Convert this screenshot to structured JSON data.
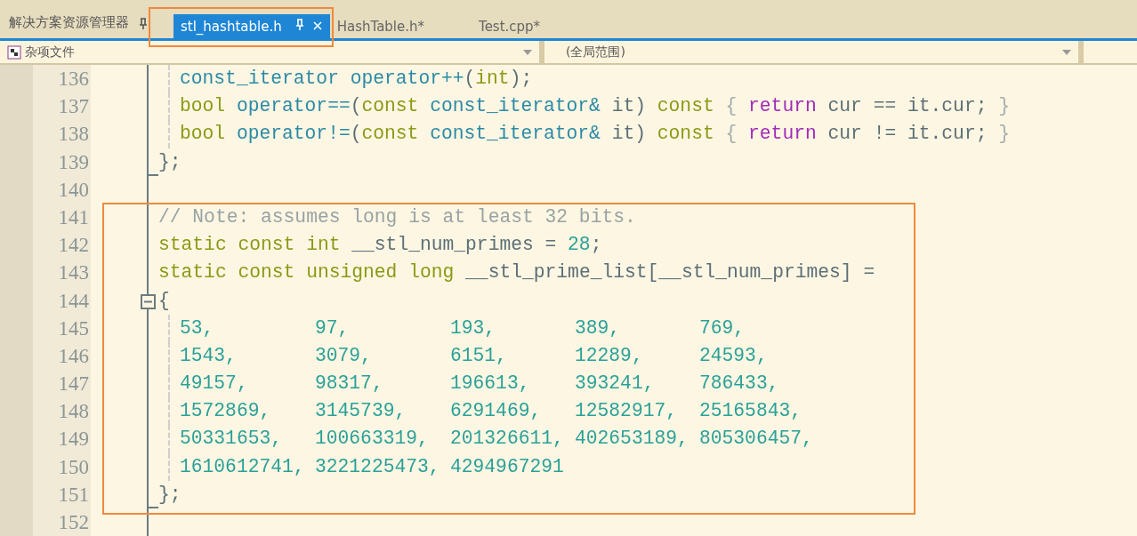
{
  "panel_title": "解决方案资源管理器",
  "tabs": [
    {
      "label": "stl_hashtable.h",
      "selected": true,
      "highlighted": true
    },
    {
      "label": "HashTable.h*",
      "selected": false,
      "highlighted": false
    },
    {
      "label": "Test.cpp*",
      "selected": false,
      "highlighted": false
    }
  ],
  "nav": {
    "project": "杂项文件",
    "scope": "(全局范围)"
  },
  "code_blocks": [
    {
      "framed": false,
      "lines": [
        {
          "number": "136",
          "kind": "body",
          "tokens": [
            {
              "t": "const_iterator operator++",
              "kind": "type"
            },
            {
              "t": "(",
              "kind": "plain"
            },
            {
              "t": "int",
              "kind": "keyword"
            },
            {
              "t": ");",
              "kind": "plain"
            }
          ]
        },
        {
          "number": "137",
          "kind": "body",
          "tokens": [
            {
              "t": "bool",
              "kind": "keyword"
            },
            {
              "t": " operator==",
              "kind": "type"
            },
            {
              "t": "(",
              "kind": "plain"
            },
            {
              "t": "const",
              "kind": "keyword"
            },
            {
              "t": " const_iterator&",
              "kind": "type"
            },
            {
              "t": " it)",
              "kind": "plain"
            },
            {
              "t": " const",
              "kind": "keyword"
            },
            {
              "t": " {",
              "kind": "brace"
            },
            {
              "t": " return",
              "kind": "control"
            },
            {
              "t": " cur == it.cur;",
              "kind": "plain"
            },
            {
              "t": " }",
              "kind": "brace"
            }
          ]
        },
        {
          "number": "138",
          "kind": "body",
          "tokens": [
            {
              "t": "bool",
              "kind": "keyword"
            },
            {
              "t": " operator!=",
              "kind": "type"
            },
            {
              "t": "(",
              "kind": "plain"
            },
            {
              "t": "const",
              "kind": "keyword"
            },
            {
              "t": " const_iterator&",
              "kind": "type"
            },
            {
              "t": " it)",
              "kind": "plain"
            },
            {
              "t": " const",
              "kind": "keyword"
            },
            {
              "t": " {",
              "kind": "brace"
            },
            {
              "t": " return",
              "kind": "control"
            },
            {
              "t": " cur != it.cur;",
              "kind": "plain"
            },
            {
              "t": " }",
              "kind": "brace"
            }
          ]
        },
        {
          "number": "139",
          "kind": "top",
          "block_end": true,
          "tokens": [
            {
              "t": "};",
              "kind": "plain"
            }
          ]
        },
        {
          "number": "140",
          "kind": "top"
        }
      ]
    },
    {
      "framed": true,
      "lines": [
        {
          "number": "141",
          "kind": "top",
          "tokens": [
            {
              "t": "// Note: assumes long is at least 32 bits.",
              "kind": "comment"
            }
          ]
        },
        {
          "number": "142",
          "kind": "top",
          "tokens": [
            {
              "t": "static const int",
              "kind": "keyword"
            },
            {
              "t": " __stl_num_primes = ",
              "kind": "plain"
            },
            {
              "t": "28",
              "kind": "number"
            },
            {
              "t": ";",
              "kind": "plain"
            }
          ]
        },
        {
          "number": "143",
          "kind": "top",
          "tokens": [
            {
              "t": "static const unsigned long",
              "kind": "keyword"
            },
            {
              "t": " __stl_prime_list[__stl_num_primes] =",
              "kind": "plain"
            }
          ]
        },
        {
          "number": "144",
          "kind": "top",
          "expanded": true,
          "tokens": [
            {
              "t": "{",
              "kind": "plain"
            }
          ]
        },
        {
          "number": "145",
          "kind": "cells",
          "cells": [
            "53,",
            "97,",
            "193,",
            "389,",
            "769,"
          ]
        },
        {
          "number": "146",
          "kind": "cells",
          "cells": [
            "1543,",
            "3079,",
            "6151,",
            "12289,",
            "24593,"
          ]
        },
        {
          "number": "147",
          "kind": "cells",
          "cells": [
            "49157,",
            "98317,",
            "196613,",
            "393241,",
            "786433,"
          ]
        },
        {
          "number": "148",
          "kind": "cells",
          "cells": [
            "1572869,",
            "3145739,",
            "6291469,",
            "12582917,",
            "25165843,"
          ]
        },
        {
          "number": "149",
          "kind": "cells",
          "cells": [
            "50331653,",
            "100663319,",
            "201326611,",
            "402653189,",
            "805306457,"
          ]
        },
        {
          "number": "150",
          "kind": "cells",
          "cells": [
            "1610612741,",
            "3221225473,",
            "4294967291"
          ]
        },
        {
          "number": "151",
          "kind": "top",
          "block_end": true,
          "tokens": [
            {
              "t": "};",
              "kind": "plain"
            }
          ]
        }
      ]
    },
    {
      "framed": false,
      "lines": [
        {
          "number": "152",
          "kind": "top"
        }
      ]
    }
  ]
}
